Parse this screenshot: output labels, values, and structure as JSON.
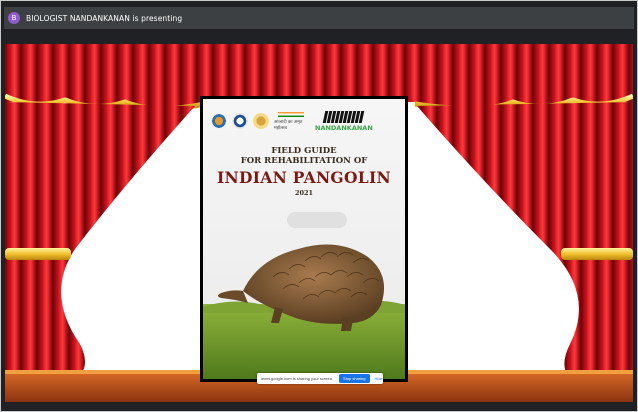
{
  "meeting": {
    "presenter_initial": "B",
    "presenter_text": "BIOLOGIST NANDANKANAN is presenting"
  },
  "cover": {
    "logo_text": "NANDANKANAN",
    "hindi_text": "आजादी का अमृत महोत्सव",
    "title_line1": "FIELD GUIDE",
    "title_line2": "FOR REHABILITATION OF",
    "title_line3": "INDIAN PANGOLIN",
    "year": "2021"
  },
  "share_bar": {
    "message": "meet.google.com is sharing your screen.",
    "stop_label": "Stop sharing",
    "hide_label": "Hide"
  },
  "colors": {
    "curtain_red": "#c1121f",
    "gold_trim": "#f2c12e",
    "stage_floor": "#c0561d",
    "meet_bar": "#3c4043",
    "accent_blue": "#1a73e8"
  }
}
